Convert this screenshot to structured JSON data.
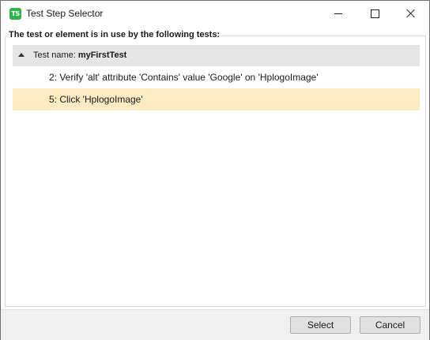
{
  "window": {
    "title": "Test Step Selector",
    "app_icon_text": "TS"
  },
  "group": {
    "title": "The test or element is in use by the following tests:"
  },
  "tree": {
    "header": {
      "prefix": "Test name:",
      "test_name": "myFirstTest"
    },
    "steps": [
      {
        "label": "2: Verify 'alt' attribute 'Contains' value 'Google' on 'HplogoImage'",
        "selected": false
      },
      {
        "label": "5: Click 'HplogoImage'",
        "selected": true
      }
    ]
  },
  "buttons": {
    "select": "Select",
    "cancel": "Cancel"
  },
  "colors": {
    "selection": "#fdebc4",
    "header": "#e5e5e5",
    "icon": "#2fb34a"
  }
}
